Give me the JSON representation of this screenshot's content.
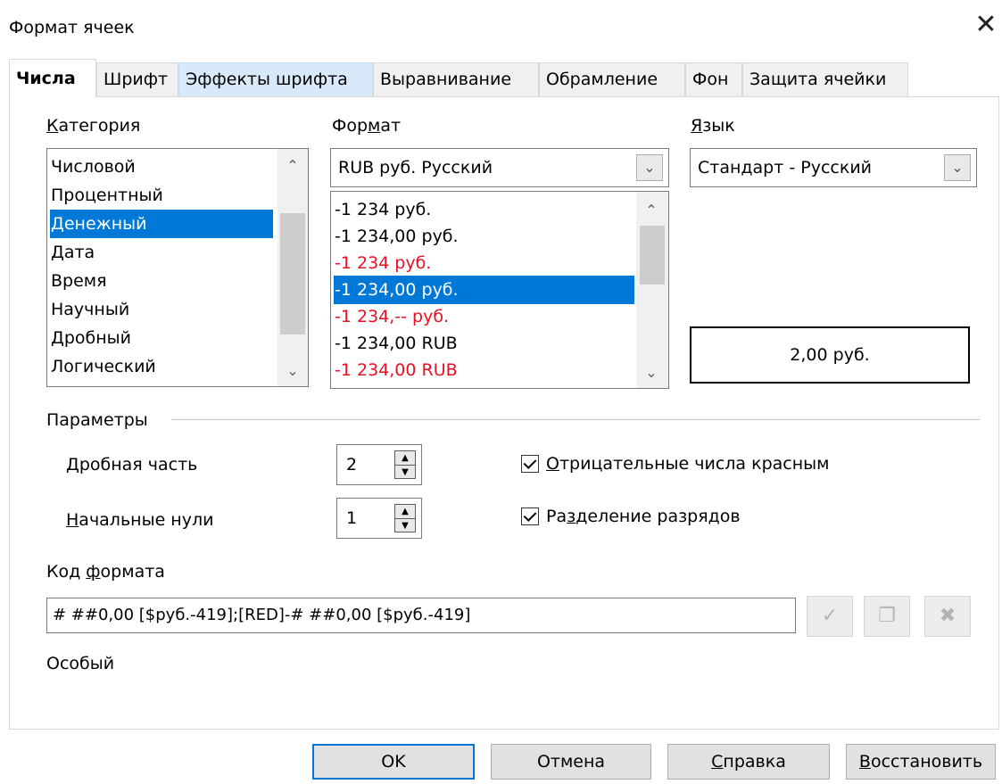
{
  "window": {
    "title": "Формат ячеек",
    "close_glyph": "✕"
  },
  "tabs": [
    {
      "label": "Числа",
      "active": true
    },
    {
      "label": "Шрифт"
    },
    {
      "label": "Эффекты шрифта",
      "hover": true
    },
    {
      "label": "Выравнивание"
    },
    {
      "label": "Обрамление"
    },
    {
      "label": "Фон"
    },
    {
      "label": "Защита ячейки"
    }
  ],
  "category": {
    "label_u": "К",
    "label_rest": "атегория",
    "items": [
      "Числовой",
      "Процентный",
      "Денежный",
      "Дата",
      "Время",
      "Научный",
      "Дробный",
      "Логический"
    ],
    "selected_index": 2
  },
  "format": {
    "label_pre": "Фор",
    "label_u": "м",
    "label_post": "ат",
    "combo_value": "RUB  руб.  Русский",
    "items": [
      {
        "text": "-1 234 руб.",
        "color": "black"
      },
      {
        "text": "-1 234,00 руб.",
        "color": "black"
      },
      {
        "text": "-1 234 руб.",
        "color": "red"
      },
      {
        "text": "-1 234,00 руб.",
        "color": "red",
        "selected": true
      },
      {
        "text": "-1 234,-- руб.",
        "color": "red"
      },
      {
        "text": "-1 234,00 RUB",
        "color": "black"
      },
      {
        "text": "-1 234,00 RUB",
        "color": "red"
      }
    ]
  },
  "language": {
    "label_u": "Я",
    "label_rest": "зык",
    "combo_value": "Стандарт - Русский"
  },
  "preview": {
    "text": "2,00 руб."
  },
  "params": {
    "label": "Параметры",
    "decimals": {
      "label_u": "Д",
      "label_rest": "робная часть",
      "value": "2"
    },
    "leading_zeros": {
      "label_u": "Н",
      "label_rest": "ачальные нули",
      "value": "1"
    },
    "negative_red": {
      "label_u": "О",
      "label_rest": "трицательные числа красным",
      "checked": true
    },
    "thousands_sep": {
      "label_pre": "Ра",
      "label_u": "з",
      "label_post": "деление разрядов",
      "checked": true
    }
  },
  "format_code": {
    "label_pre": "Код ",
    "label_u": "ф",
    "label_post": "ормата",
    "value": "# ##0,00 [$руб.-419];[RED]-# ##0,00 [$руб.-419]",
    "comment": "Особый"
  },
  "buttons": {
    "ok": "OK",
    "cancel": "Отмена",
    "help_u": "С",
    "help_rest": "правка",
    "reset_u": "В",
    "reset_rest": "осстановить"
  }
}
